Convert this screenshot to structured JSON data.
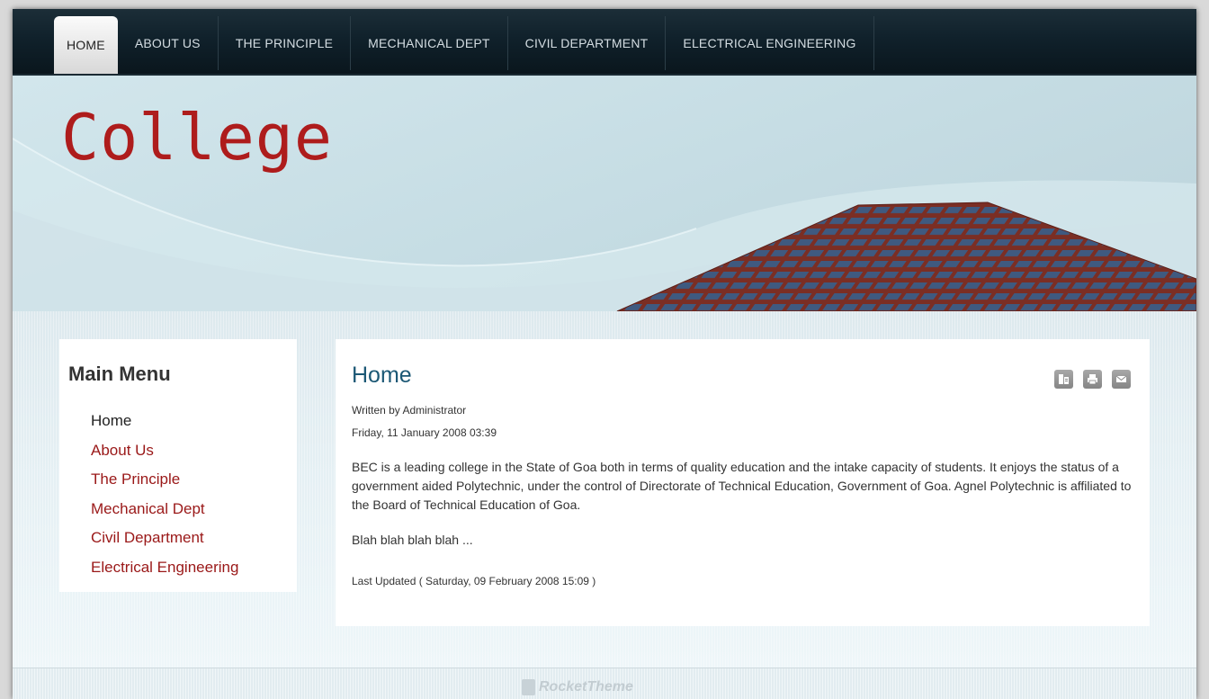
{
  "nav": {
    "items": [
      {
        "label": "HOME",
        "active": true
      },
      {
        "label": "ABOUT US"
      },
      {
        "label": "THE PRINCIPLE"
      },
      {
        "label": "MECHANICAL DEPT"
      },
      {
        "label": "CIVIL DEPARTMENT"
      },
      {
        "label": "ELECTRICAL ENGINEERING"
      }
    ]
  },
  "header": {
    "logo_text": "College"
  },
  "sidebar": {
    "title": "Main Menu",
    "items": [
      {
        "label": "Home",
        "current": true
      },
      {
        "label": "About Us"
      },
      {
        "label": "The Principle"
      },
      {
        "label": "Mechanical Dept"
      },
      {
        "label": "Civil Department"
      },
      {
        "label": "Electrical Engineering"
      }
    ]
  },
  "article": {
    "title": "Home",
    "author": "Written by Administrator",
    "date": "Friday, 11 January 2008 03:39",
    "body": "BEC is a leading college in the State of Goa both in terms of quality education and the intake capacity of students. It enjoys the status of a government aided Polytechnic, under the control of Directorate of Technical Education, Government of Goa. Agnel Polytechnic is affiliated to the Board of Technical Education of Goa.",
    "extra": "Blah blah blah blah ...",
    "last_updated": "Last Updated ( Saturday, 09 February 2008 15:09 )",
    "icons": [
      "pdf-icon",
      "print-icon",
      "email-icon"
    ]
  },
  "footer": {
    "brand": "RocketTheme"
  },
  "colors": {
    "nav_bg": "#10212b",
    "logo_red": "#ae1c1c",
    "menu_link": "#9a1818",
    "title_blue": "#1c5875"
  }
}
